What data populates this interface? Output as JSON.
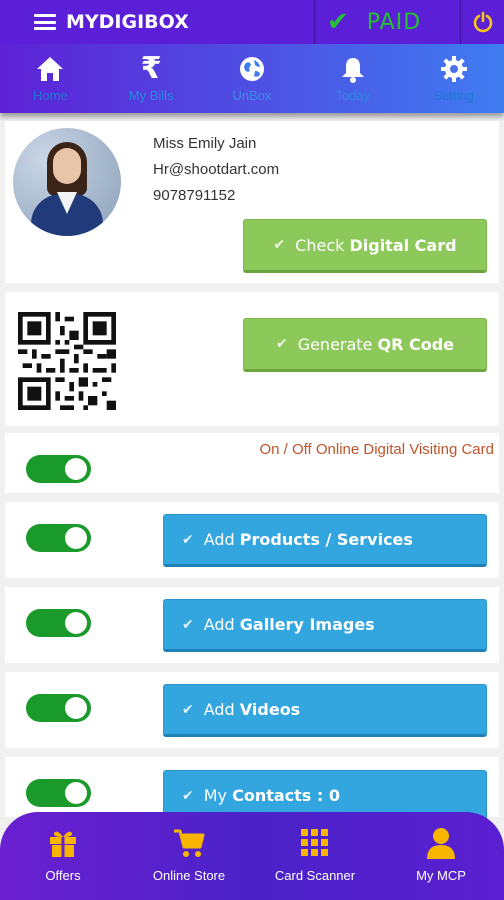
{
  "app": {
    "title": "MYDIGIBOX",
    "status": "PAID"
  },
  "nav": [
    {
      "label": "Home",
      "icon": "home-icon"
    },
    {
      "label": "My Bills",
      "icon": "rupee-icon"
    },
    {
      "label": "UnBox",
      "icon": "globe-icon"
    },
    {
      "label": "Today",
      "icon": "bell-icon"
    },
    {
      "label": "Setting",
      "icon": "gear-icon"
    }
  ],
  "profile": {
    "name": "Miss Emily Jain",
    "email": "Hr@shootdart.com",
    "phone": "9078791152"
  },
  "buttons": {
    "check_card": {
      "prefix": "Check ",
      "bold": "Digital Card"
    },
    "qr": {
      "prefix": "Generate ",
      "bold": "QR Code"
    },
    "products": {
      "prefix": "Add ",
      "bold": "Products / Services"
    },
    "gallery": {
      "prefix": "Add ",
      "bold": "Gallery Images"
    },
    "videos": {
      "prefix": "Add ",
      "bold": "Videos"
    },
    "contacts": {
      "prefix": "My ",
      "bold": "Contacts : 0"
    }
  },
  "online_toggle_label": "On / Off Online Digital Visiting Card",
  "bottom_nav": [
    {
      "label": "Offers",
      "icon": "gift-icon"
    },
    {
      "label": "Online Store",
      "icon": "cart-icon"
    },
    {
      "label": "Card Scanner",
      "icon": "grid-icon"
    },
    {
      "label": "My MCP",
      "icon": "user-icon"
    }
  ],
  "colors": {
    "header": "#5b1fd8",
    "accent_green": "#8dc95a",
    "accent_blue": "#33a6e0",
    "toggle_on": "#199a2a",
    "paid": "#22c12e",
    "nav_label": "#1e78d8",
    "notice": "#c0542a"
  }
}
